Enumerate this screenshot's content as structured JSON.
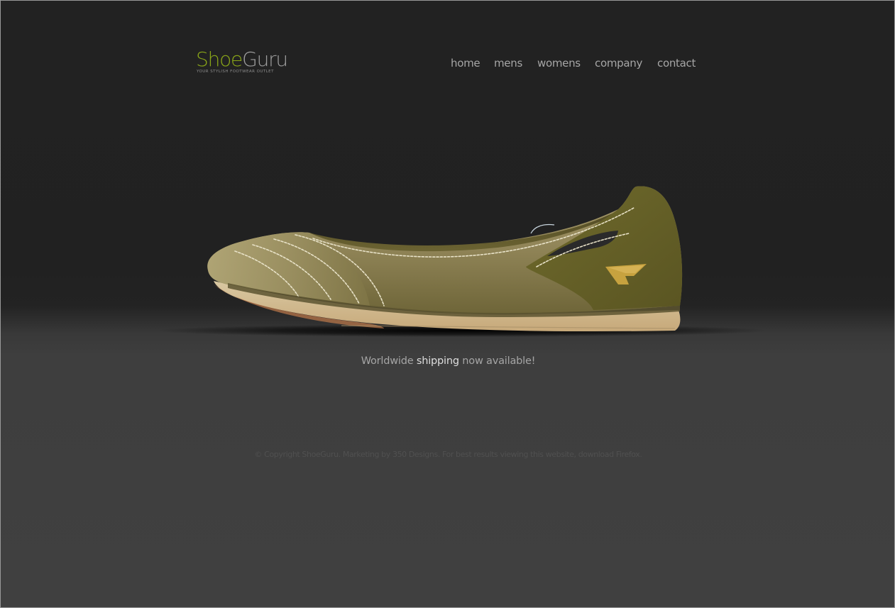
{
  "brand": {
    "name_part1": "Shoe",
    "name_part2": "Guru",
    "tagline": "YOUR STYLISH FOOTWEAR OUTLET"
  },
  "nav": {
    "items": [
      {
        "label": "home"
      },
      {
        "label": "mens"
      },
      {
        "label": "womens"
      },
      {
        "label": "company"
      },
      {
        "label": "contact"
      }
    ]
  },
  "hero": {
    "image": "olive-canvas-flat-shoe"
  },
  "promo": {
    "before": "Worldwide ",
    "highlight": "shipping",
    "after": " now available!"
  },
  "footer": {
    "text": "© Copyright ShoeGuru. Marketing by 350 Designs. For best results viewing this website, download Firefox."
  },
  "colors": {
    "brand_green": "#8aa618",
    "nav_text": "#a6a6a6",
    "background_top": "#222222",
    "background_bottom": "#404040"
  }
}
